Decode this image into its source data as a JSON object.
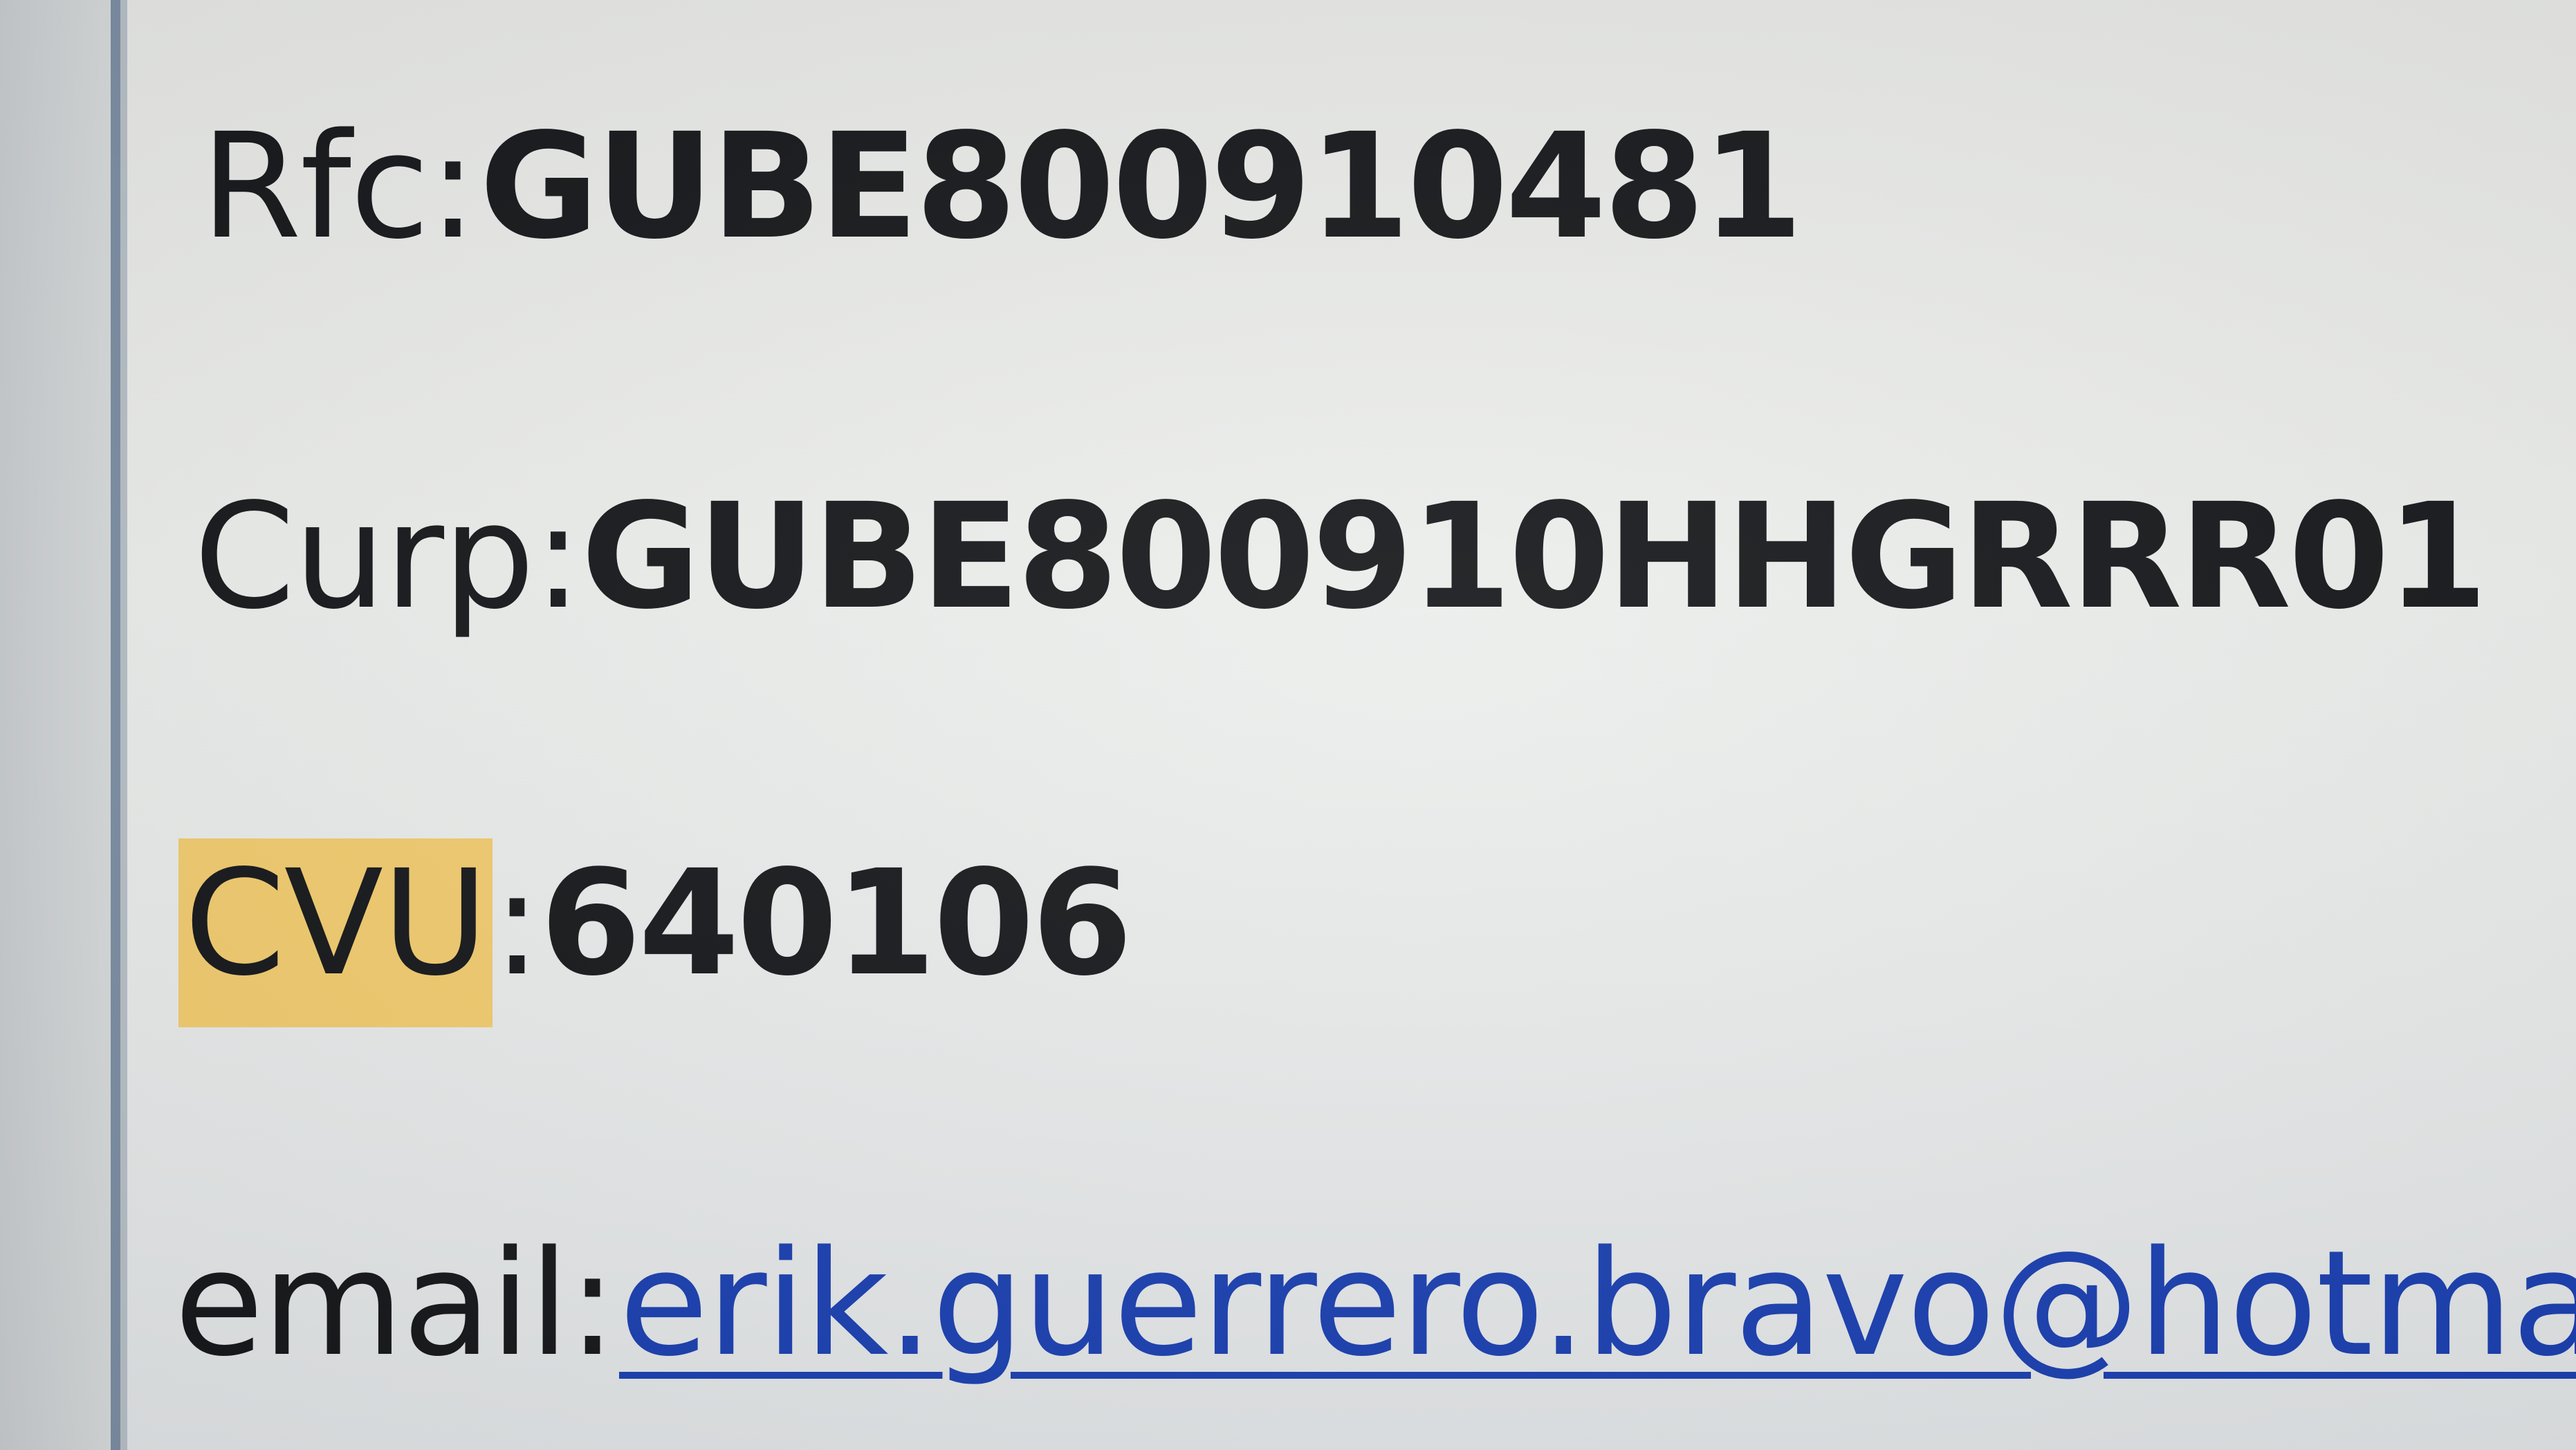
{
  "fields": {
    "rfc": {
      "label": "Rfc:",
      "value": "GUBE800910481"
    },
    "curp": {
      "label": "Curp:",
      "value": "GUBE800910HHGRRR01"
    },
    "cvu": {
      "label": "CVU",
      "separator": ":",
      "value": "640106"
    },
    "email": {
      "label": "email:",
      "value": "erik.guerrero.bravo@hotma"
    }
  },
  "colors": {
    "highlight": "#f1cb6e",
    "link": "#1a3fb0",
    "text": "#15171a",
    "gutter_border": "#7c8ea3"
  }
}
